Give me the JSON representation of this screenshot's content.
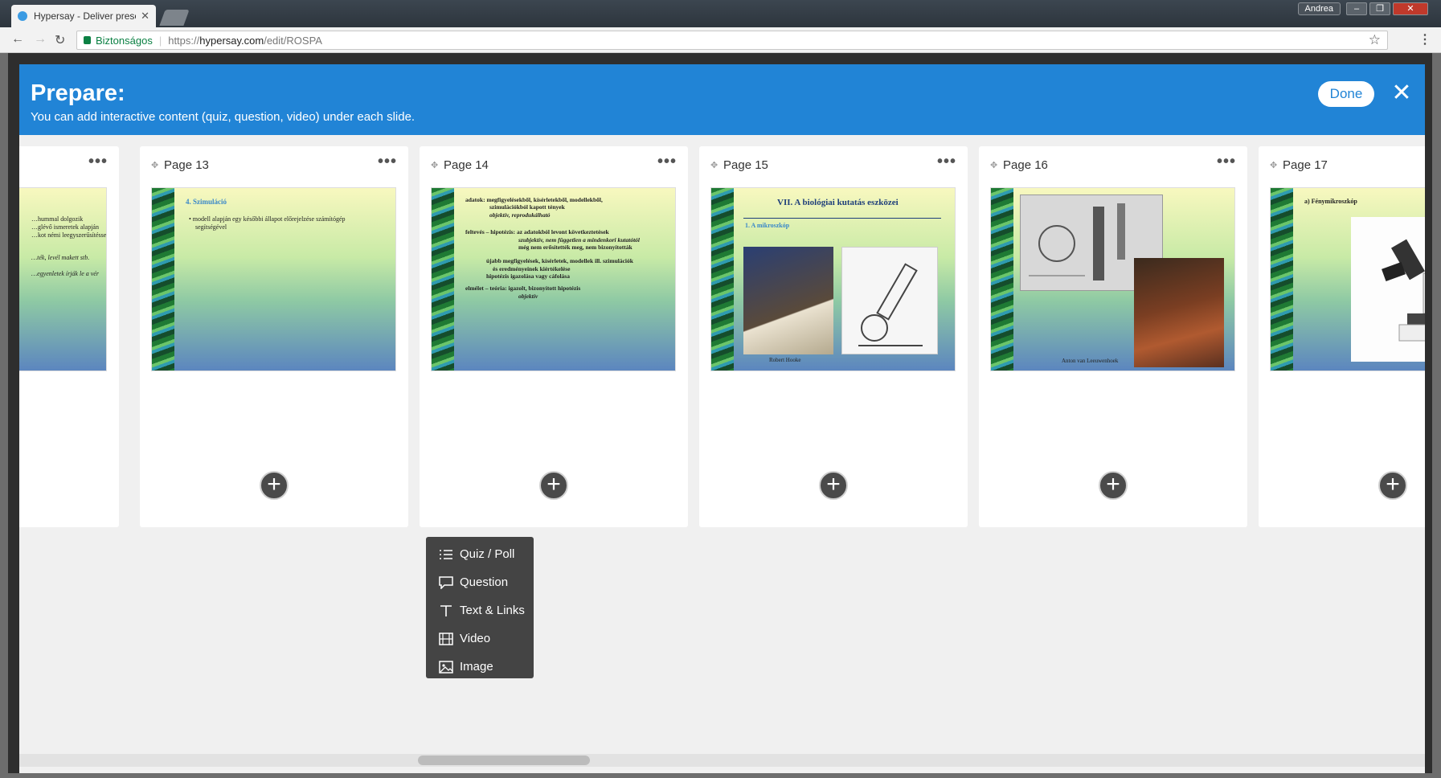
{
  "browser": {
    "tab_title": "Hypersay - Deliver preser",
    "user_name": "Andrea",
    "secure_label": "Biztonságos",
    "url_scheme": "https://",
    "url_host": "hypersay.com",
    "url_path": "/edit/ROSPA"
  },
  "header": {
    "title": "Prepare:",
    "subtitle": "You can add interactive content (quiz, question, video) under each slide.",
    "done_label": "Done"
  },
  "columns": [
    {
      "label": "",
      "slide": {
        "lines": [
          "…hummal dolgozik",
          "…glévő ismeretek alapján",
          "…kot némi leegyszerűsítéssel",
          "",
          "…ték, levél makett stb.",
          "",
          "…egyenletek írják le a vér"
        ]
      }
    },
    {
      "label": "Page 13",
      "slide": {
        "heading": "4. Szimuláció",
        "lines": [
          "• modell alapján egy későbbi állapot előrejelzése számítógép",
          "segítségével"
        ]
      }
    },
    {
      "label": "Page 14",
      "slide": {
        "lines": [
          "adatok: megfigyelésekből, kísérletekből, modellekből,",
          "szimulációkból kapott tények",
          "objektív, reprodukálható",
          "feltevés – hipotézis: az adatokból levont következtetések",
          "szubjektív, nem független a mindenkori kutatótól",
          "még nem erősítették meg, nem bizonyították",
          "újabb megfigyelések, kísérletek, modellek ill. szimulációk",
          "és eredményeinek kiértékelése",
          "hipotézis igazolása vagy cáfolása",
          "elmélet – teória: igazolt, bizonyított hipotézis",
          "objektív"
        ]
      }
    },
    {
      "label": "Page 15",
      "slide": {
        "heading": "VII. A biológiai kutatás eszközei",
        "sub": "1. A mikroszkóp",
        "caption": "Robert Hooke"
      }
    },
    {
      "label": "Page 16",
      "slide": {
        "caption": "Anton van Leeuwenhoek"
      }
    },
    {
      "label": "Page 17",
      "slide": {
        "heading": "a) Fénymikroszkóp"
      }
    }
  ],
  "popup_menu": {
    "items": [
      {
        "label": "Quiz / Poll",
        "icon": "list-icon"
      },
      {
        "label": "Question",
        "icon": "speech-bubble-icon"
      },
      {
        "label": "Text & Links",
        "icon": "text-icon"
      },
      {
        "label": "Video",
        "icon": "film-icon"
      },
      {
        "label": "Image",
        "icon": "image-icon"
      }
    ]
  }
}
